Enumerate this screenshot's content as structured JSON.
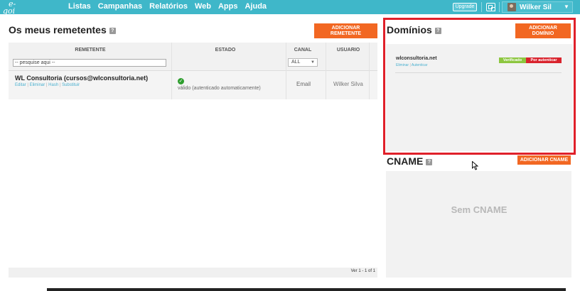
{
  "topbar": {
    "logo_line1": "e-",
    "logo_line2": "goi",
    "nav": [
      "Listas",
      "Campanhas",
      "Relatórios",
      "Web",
      "Apps",
      "Ajuda"
    ],
    "upgrade_label": "Upgrade",
    "user_name": "Wilker Sil"
  },
  "senders": {
    "title": "Os meus remetentes",
    "add_button": [
      "ADICIONAR",
      "REMETENTE"
    ],
    "columns": [
      "REMETENTE",
      "ESTADO",
      "CANAL",
      "USUARIO"
    ],
    "search_placeholder": "-- pesquise aqui --",
    "channel_filter": "ALL",
    "row": {
      "name": "WL Consultoria (cursos@wlconsultoria.net)",
      "actions": [
        "Editar",
        "Eliminar",
        "Hash",
        "Substituir"
      ],
      "status": "válido (autenticado automaticamente)",
      "channel": "Email",
      "user": "Wilker Silva"
    },
    "pager": "Ver 1 - 1 of 1"
  },
  "domains": {
    "title": "Domínios",
    "add_button": [
      "ADICIONAR",
      "DOMÍNIO"
    ],
    "item": {
      "name": "wlconsultoria.net",
      "actions": [
        "Eliminar",
        "Autenticar"
      ],
      "badges": [
        {
          "label": "Verificado",
          "color": "#8cc63f"
        },
        {
          "label": "Por autenticar",
          "color": "#d9232d"
        }
      ]
    }
  },
  "cname": {
    "title": "CNAME",
    "add_button": "ADICIONAR CNAME",
    "empty_text": "Sem CNAME"
  },
  "colors": {
    "topbar": "#3fb7c9",
    "accent_orange": "#f26722",
    "highlight_red": "#e0202a",
    "link": "#4ab0cf"
  }
}
